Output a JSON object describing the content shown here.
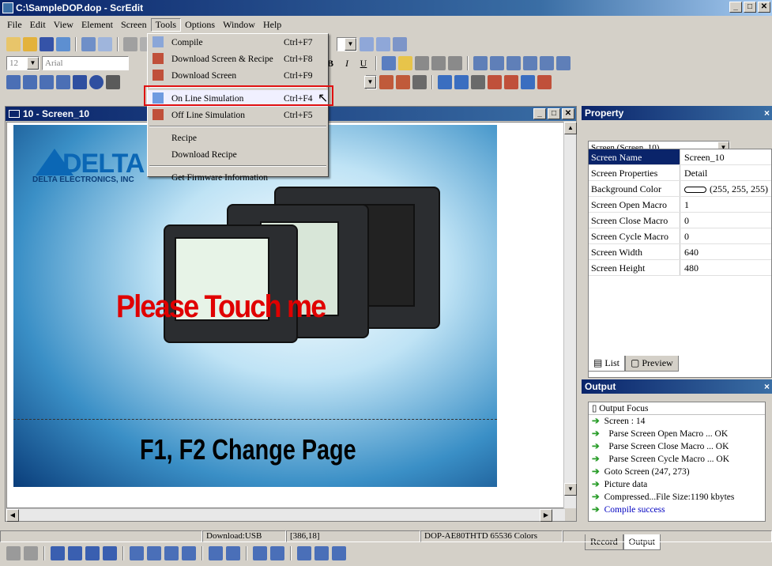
{
  "window": {
    "title": "C:\\SampleDOP.dop - ScrEdit",
    "controls": [
      "_",
      "□",
      "✕"
    ]
  },
  "menubar": [
    "File",
    "Edit",
    "View",
    "Element",
    "Screen",
    "Tools",
    "Options",
    "Window",
    "Help"
  ],
  "toolbar": {
    "font_size": "12",
    "font_name": "Arial",
    "page_num": "0"
  },
  "tools_menu": {
    "items": [
      {
        "label": "Compile",
        "shortcut": "Ctrl+F7",
        "icon": "compile-icon"
      },
      {
        "label": "Download Screen & Recipe",
        "shortcut": "Ctrl+F8",
        "icon": "download-recipe-icon"
      },
      {
        "label": "Download Screen",
        "shortcut": "Ctrl+F9",
        "icon": "download-screen-icon"
      },
      {
        "label": "On Line Simulation",
        "shortcut": "Ctrl+F4",
        "icon": "online-sim-icon"
      },
      {
        "label": "Off Line Simulation",
        "shortcut": "Ctrl+F5",
        "icon": "offline-sim-icon"
      },
      {
        "label": "Recipe",
        "shortcut": ""
      },
      {
        "label": "Download Recipe",
        "shortcut": ""
      },
      {
        "label": "Get Firmware Information",
        "shortcut": ""
      }
    ]
  },
  "document": {
    "title": "10 - Screen_10",
    "logo_text": "DELTA",
    "logo_sub": "DELTA ELECTRONICS, INC",
    "touch_text": "Please Touch me",
    "change_text": "F1, F2  Change Page"
  },
  "property": {
    "title": "Property",
    "selector": "Screen (Screen_10)",
    "rows": [
      {
        "key": "Screen Name",
        "value": "Screen_10"
      },
      {
        "key": "Screen Properties",
        "value": "Detail"
      },
      {
        "key": "Background Color",
        "value": "(255, 255, 255)"
      },
      {
        "key": "Screen Open Macro",
        "value": "1"
      },
      {
        "key": "Screen Close Macro",
        "value": "0"
      },
      {
        "key": "Screen Cycle Macro",
        "value": "0"
      },
      {
        "key": "Screen Width",
        "value": "640"
      },
      {
        "key": "Screen Height",
        "value": "480"
      }
    ],
    "tabs": [
      "List",
      "Preview"
    ]
  },
  "output": {
    "title": "Output",
    "header": "Output Focus",
    "lines": [
      "Screen : 14",
      "Parse Screen Open Macro ... OK",
      "Parse Screen Close Macro ... OK",
      "Parse Screen Cycle Macro ... OK",
      "Goto Screen (247, 273)",
      "Picture data",
      "Compressed...File Size:1190 kbytes",
      "Compile success"
    ],
    "tabs": [
      "Record",
      "Output"
    ]
  },
  "statusbar": {
    "download": "Download:USB",
    "coords": "[386,18]",
    "model": "DOP-AE80THTD 65536 Colors"
  },
  "colors": {
    "titlebar": "#0a246a",
    "highlight": "#e01010",
    "touch_text": "#e00000"
  }
}
